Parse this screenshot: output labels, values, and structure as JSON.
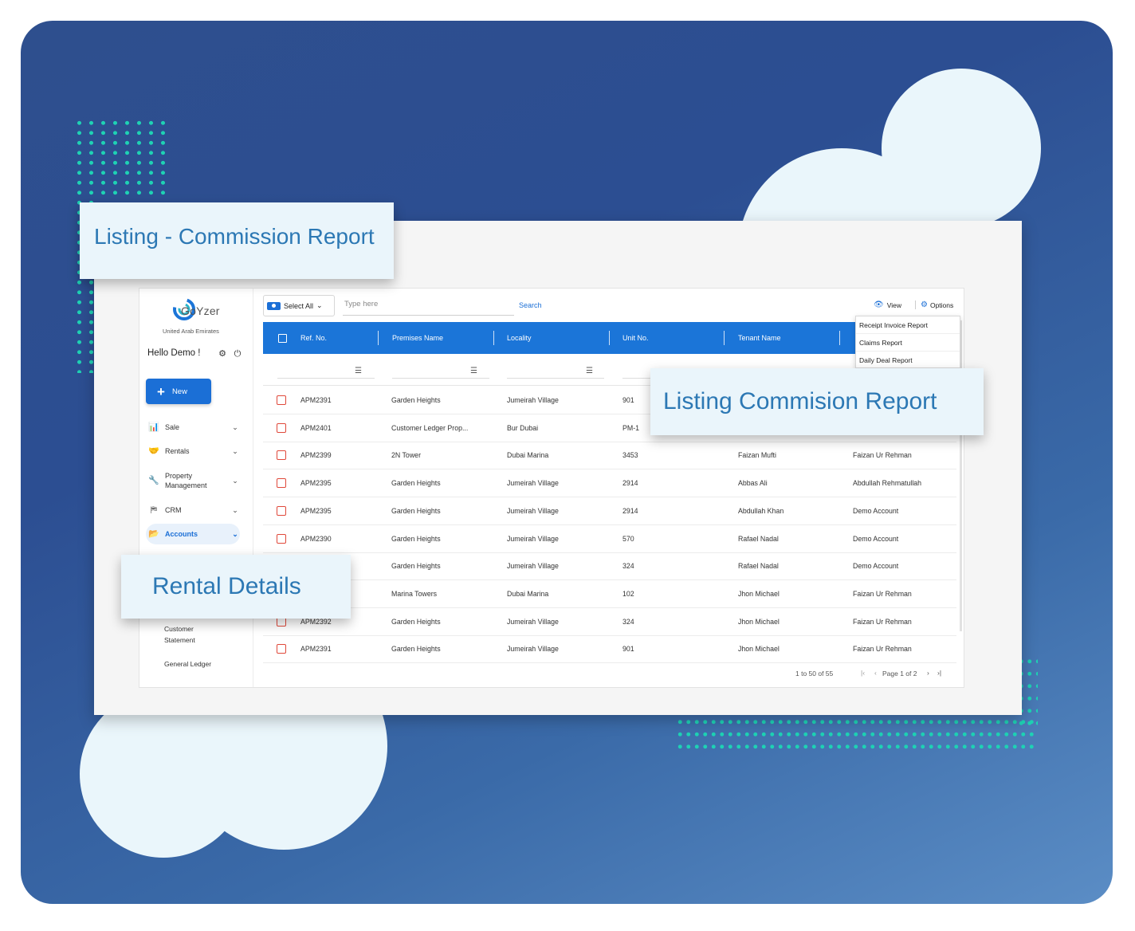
{
  "callouts": {
    "top_left": "Listing - Commission Report",
    "right": "Listing Commision Report",
    "left": "Rental Details"
  },
  "app": {
    "logo_text": "GoYzer",
    "logo_subtitle": "United Arab Emirates",
    "greeting": "Hello Demo !",
    "new_button": "New",
    "nav": [
      {
        "label": "Sale",
        "icon": "bar-chart-icon"
      },
      {
        "label": "Rentals",
        "icon": "handshake-icon"
      },
      {
        "label": "Property Management",
        "icon": "wrench-icon"
      },
      {
        "label": "CRM",
        "icon": "crm-icon"
      },
      {
        "label": "Accounts",
        "icon": "folder-icon",
        "active": true
      }
    ],
    "subnav": [
      "Customer Statement",
      "General Ledger"
    ],
    "accent_color": "#1b75d8"
  },
  "toolbar": {
    "select_all": "Select All",
    "search_placeholder": "Type here",
    "search_button": "Search",
    "view": "View",
    "options": "Options"
  },
  "options_menu": [
    "Receipt Invoice Report",
    "Claims Report",
    "Daily Deal Report"
  ],
  "table": {
    "columns": [
      "Ref. No.",
      "Premises Name",
      "Locality",
      "Unit No.",
      "Tenant Name"
    ],
    "rows": [
      {
        "ref": "APM2391",
        "premises": "Garden Heights",
        "locality": "Jumeirah Village",
        "unit": "901",
        "tenant": "",
        "owner": ""
      },
      {
        "ref": "APM2401",
        "premises": "Customer Ledger Prop...",
        "locality": "Bur Dubai",
        "unit": "PM-1",
        "tenant": "",
        "owner": ""
      },
      {
        "ref": "APM2399",
        "premises": "2N Tower",
        "locality": "Dubai Marina",
        "unit": "3453",
        "tenant": "Faizan Mufti",
        "owner": "Faizan Ur Rehman"
      },
      {
        "ref": "APM2395",
        "premises": "Garden Heights",
        "locality": "Jumeirah Village",
        "unit": "2914",
        "tenant": "Abbas Ali",
        "owner": "Abdullah Rehmatullah"
      },
      {
        "ref": "APM2395",
        "premises": "Garden Heights",
        "locality": "Jumeirah Village",
        "unit": "2914",
        "tenant": "Abdullah Khan",
        "owner": "Demo Account"
      },
      {
        "ref": "APM2390",
        "premises": "Garden Heights",
        "locality": "Jumeirah Village",
        "unit": "570",
        "tenant": "Rafael Nadal",
        "owner": "Demo Account"
      },
      {
        "ref": "",
        "premises": "Garden Heights",
        "locality": "Jumeirah Village",
        "unit": "324",
        "tenant": "Rafael Nadal",
        "owner": "Demo Account"
      },
      {
        "ref": "",
        "premises": "Marina Towers",
        "locality": "Dubai Marina",
        "unit": "102",
        "tenant": "Jhon Michael",
        "owner": "Faizan Ur Rehman"
      },
      {
        "ref": "APM2392",
        "premises": "Garden Heights",
        "locality": "Jumeirah Village",
        "unit": "324",
        "tenant": "Jhon Michael",
        "owner": "Faizan Ur Rehman"
      },
      {
        "ref": "APM2391",
        "premises": "Garden Heights",
        "locality": "Jumeirah Village",
        "unit": "901",
        "tenant": "Jhon Michael",
        "owner": "Faizan Ur Rehman"
      }
    ]
  },
  "pagination": {
    "range": "1 to 50 of 55",
    "page": "Page 1 of 2"
  }
}
